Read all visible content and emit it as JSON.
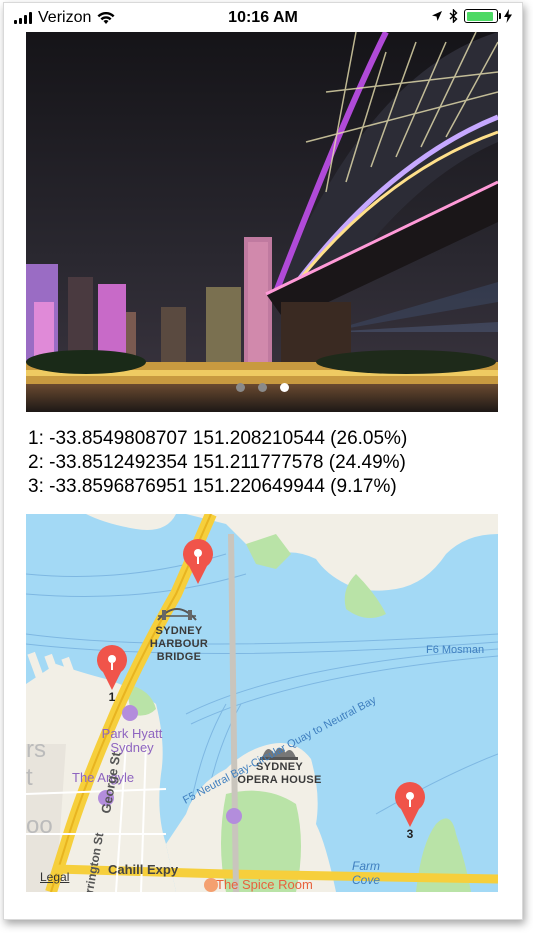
{
  "status_bar": {
    "carrier": "Verizon",
    "time": "10:16 AM",
    "battery_level": 0.9
  },
  "carousel": {
    "image_icon": "photo-image",
    "page_count": 3,
    "active_page": 3
  },
  "results": [
    "1: -33.8549808707 151.208210544 (26.05%)",
    "2: -33.8512492354 151.211777578 (24.49%)",
    "3: -33.8596876951 151.220649944 (9.17%)"
  ],
  "map": {
    "labels": {
      "harbour_bridge": "SYDNEY\nHARBOUR\nBRIDGE",
      "opera_house": "SYDNEY\nOPERA HOUSE",
      "park_hyatt": "Park Hyatt\nSydney",
      "the_argyle": "The Argyle",
      "george_st": "George St",
      "cahill_expy": "Cahill Expy",
      "farm_cove": "Farm\nCove",
      "spice_room": "The Spice Room",
      "ferry_route": "F5 Neutral Bay-Circular Quay to Neutral Bay",
      "ferry_route_short": "F5 Neutral Bay-Circular Quay to Neutral Bay",
      "f6": "F6 Mosman",
      "legal": "Legal",
      "rs": "rs",
      "t": "t",
      "oo": "oo",
      "rrington": "rrington St"
    },
    "pins": [
      {
        "label": "",
        "color": "#f0544a"
      },
      {
        "label": "1",
        "color": "#f0544a"
      },
      {
        "label": "3",
        "color": "#f0544a"
      }
    ]
  }
}
